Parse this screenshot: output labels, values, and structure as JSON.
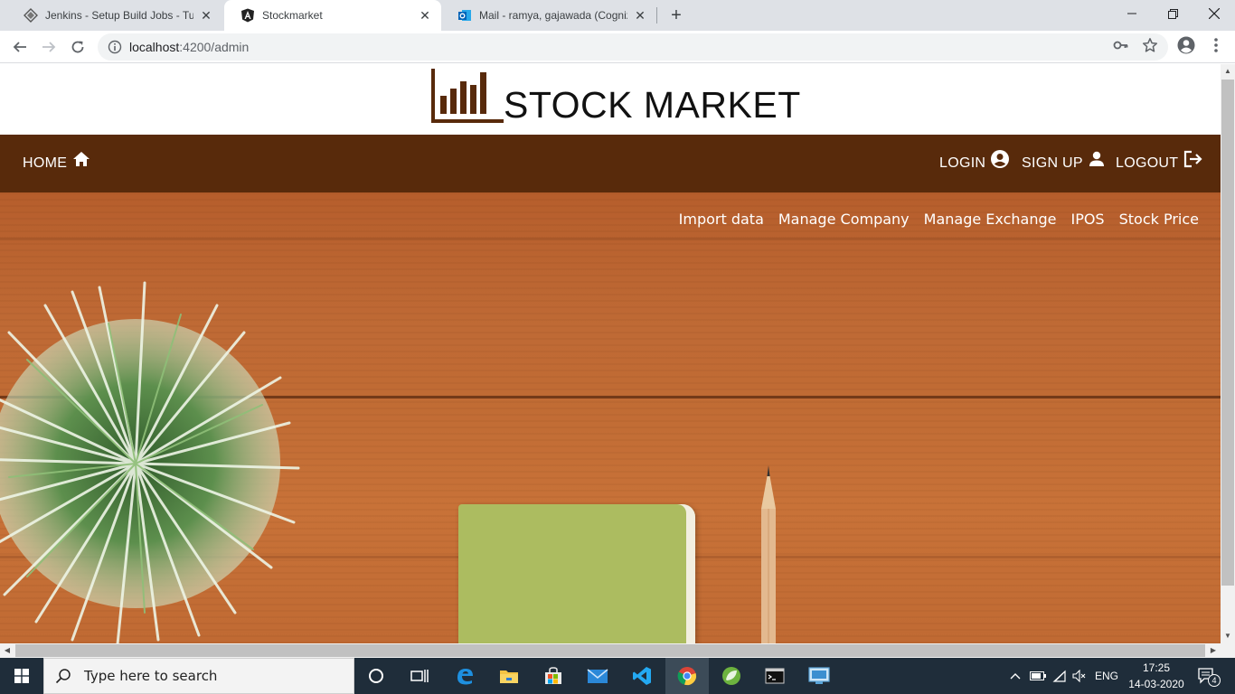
{
  "browser": {
    "tabs": [
      {
        "title": "Jenkins - Setup Build Jobs - Tuto",
        "active": false,
        "favicon": "jenkins-icon"
      },
      {
        "title": "Stockmarket",
        "active": true,
        "favicon": "angular-icon"
      },
      {
        "title": "Mail - ramya, gajawada (Cogniza",
        "active": false,
        "favicon": "outlook-icon"
      }
    ],
    "new_tab_label": "+",
    "address": {
      "host": "localhost",
      "port_path": ":4200/admin"
    }
  },
  "site": {
    "title": "STOCK MARKET",
    "logo_icon": "bar-chart-icon",
    "brand_color": "#582a0b"
  },
  "nav": {
    "home": "HOME",
    "login": "LOGIN",
    "signup": "SIGN UP",
    "logout": "LOGOUT"
  },
  "admin_menu": [
    "Import data",
    "Manage Company",
    "Manage Exchange",
    "IPOS",
    "Stock Price"
  ],
  "taskbar": {
    "search_placeholder": "Type here to search",
    "language": "ENG",
    "time": "17:25",
    "date": "14-03-2020",
    "notification_count": "4"
  }
}
